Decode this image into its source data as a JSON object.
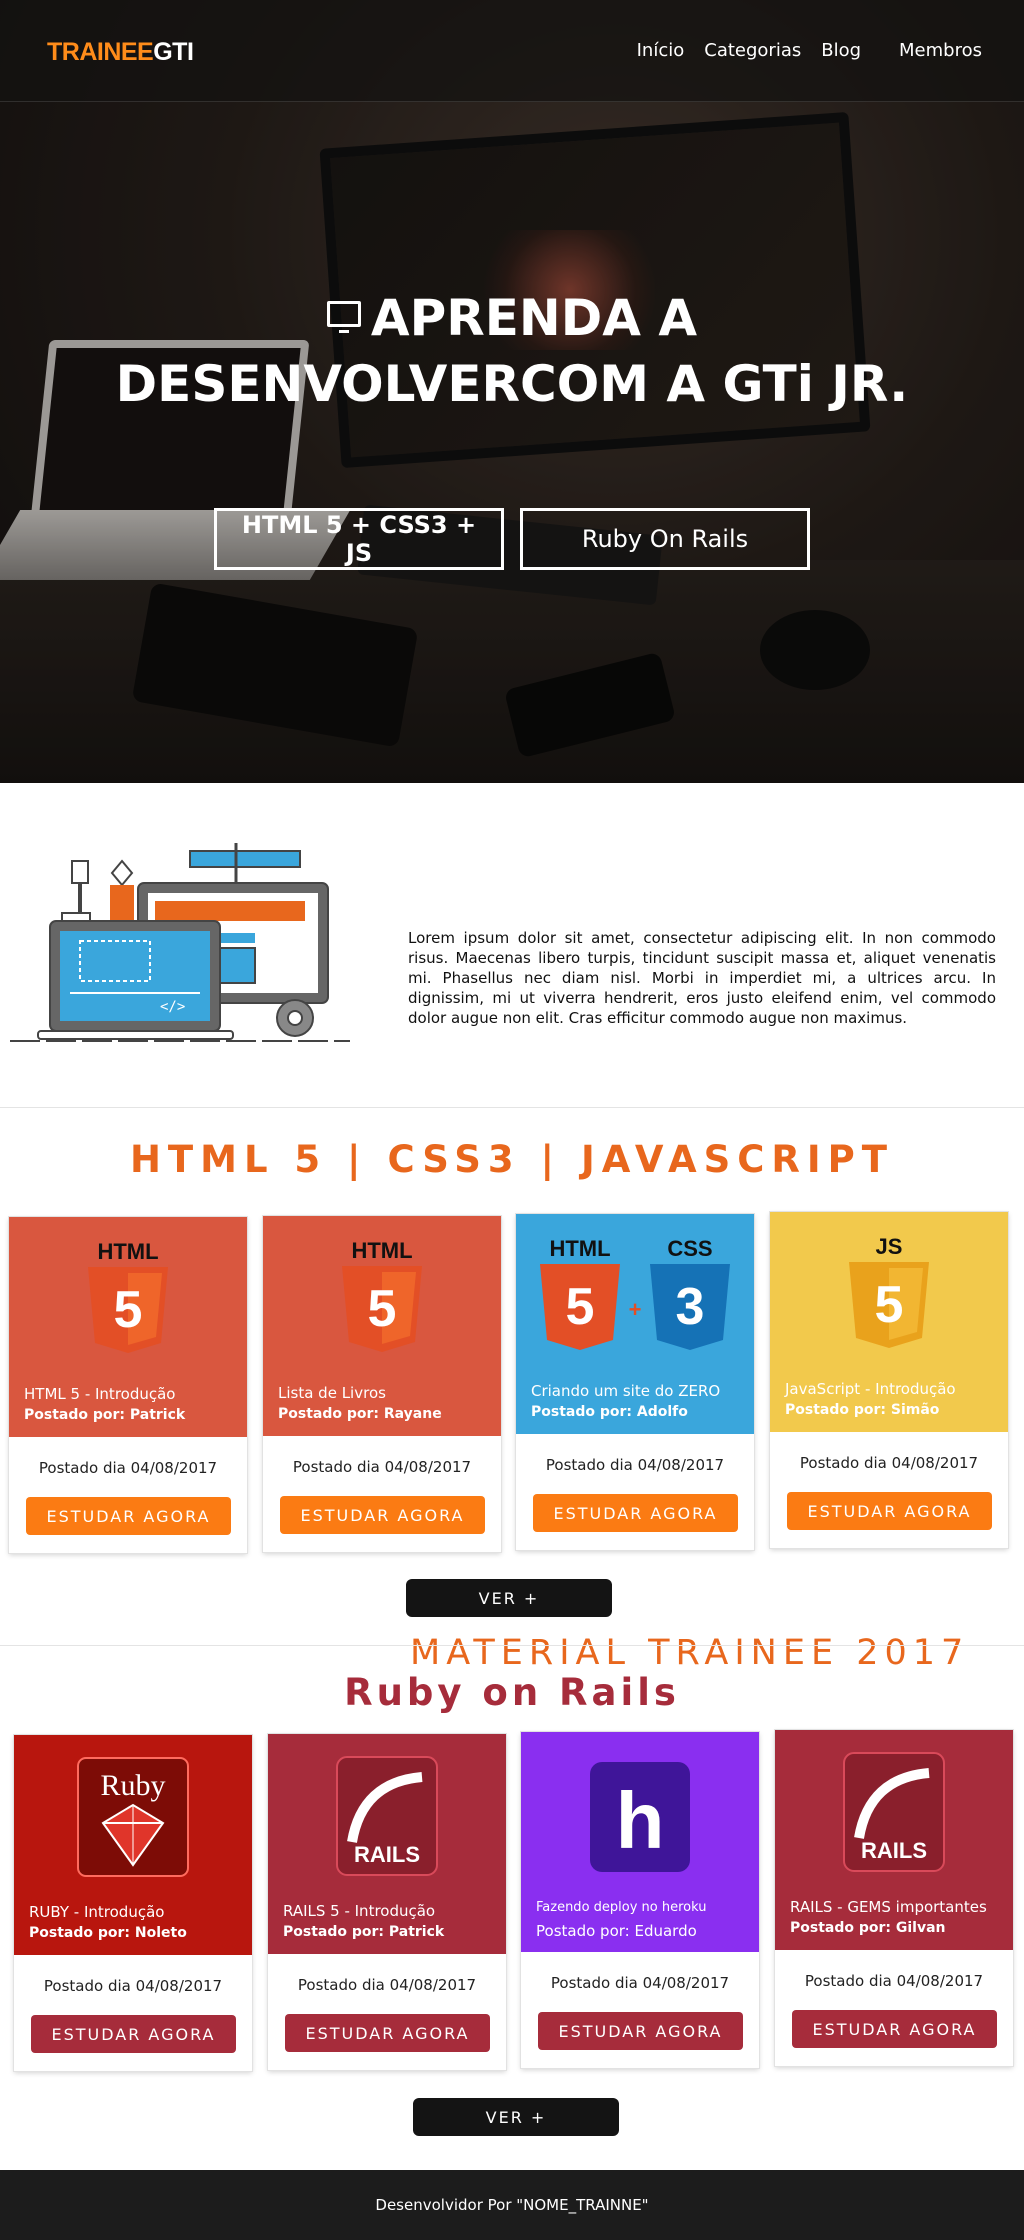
{
  "nav": {
    "logo_part1": "TRAINEE",
    "logo_part2": "GTI",
    "items": [
      {
        "label": "Início"
      },
      {
        "label": "Categorias"
      },
      {
        "label": "Blog"
      },
      {
        "label": "Membros"
      }
    ]
  },
  "hero": {
    "title_line1": "APRENDA A",
    "title_line2": "DESENVOLVERCOM A GTi JR.",
    "buttons": [
      {
        "label": "HTML 5 + CSS3 + JS"
      },
      {
        "label": "Ruby On Rails"
      }
    ]
  },
  "about": {
    "title": "MATERIAL TRAINEE 2017",
    "text": "Lorem ipsum dolor sit amet, consectetur adipiscing elit. In non commodo risus. Maecenas libero turpis, tincidunt suscipit massa et, aliquet venenatis mi. Phasellus nec diam nisl. Morbi in imperdiet mi, a ultrices arcu. In dignissim, mi ut viverra hendrerit, eros justo eleifend enim, vel commodo dolor augue non elit. Cras efficitur commodo augue non maximus."
  },
  "web_section": {
    "title": "HTML 5 | CSS3 | JAVASCRIPT",
    "cards": [
      {
        "title": "HTML 5 - Introdução",
        "author": "Postado por: Patrick",
        "date": "Postado dia 04/08/2017",
        "button": "ESTUDAR AGORA",
        "color": "#d9573f"
      },
      {
        "title": "Lista de Livros",
        "author": "Postado por: Rayane",
        "date": "Postado dia 04/08/2017",
        "button": "ESTUDAR AGORA",
        "color": "#d9573f"
      },
      {
        "title": "Criando um site do ZERO",
        "author": "Postado por: Adolfo",
        "date": "Postado dia 04/08/2017",
        "button": "ESTUDAR AGORA",
        "color": "#3aa6dc"
      },
      {
        "title": "JavaScript - Introdução",
        "author": "Postado por: Simão",
        "date": "Postado dia 04/08/2017",
        "button": "ESTUDAR AGORA",
        "color": "#f2c94c"
      }
    ],
    "more_button": "VER +"
  },
  "rails_section": {
    "title": "Ruby on Rails",
    "cards": [
      {
        "title": "RUBY - Introdução",
        "author": "Postado por: Noleto",
        "date": "Postado dia 04/08/2017",
        "button": "ESTUDAR AGORA",
        "color": "#b8160e"
      },
      {
        "title": "RAILS 5 - Introdução",
        "author": "Postado por: Patrick",
        "date": "Postado dia 04/08/2017",
        "button": "ESTUDAR AGORA",
        "color": "#a62c3b"
      },
      {
        "title": "Fazendo deploy no heroku",
        "author": "Postado por: Eduardo",
        "date": "Postado dia 04/08/2017",
        "button": "ESTUDAR AGORA",
        "color": "#8a2ff0"
      },
      {
        "title": "RAILS - GEMS importantes",
        "author": "Postado por: Gilvan",
        "date": "Postado dia 04/08/2017",
        "button": "ESTUDAR AGORA",
        "color": "#a62c3b"
      }
    ],
    "more_button": "VER +"
  },
  "badges": {
    "html": "HTML",
    "css": "CSS",
    "js": "JS",
    "five": "5",
    "three": "3",
    "plus": "+",
    "ruby": "Ruby",
    "rails": "RAILS",
    "heroku": "h"
  },
  "footer": {
    "text": "Desenvolvidor Por \"NOME_TRAINNE\""
  }
}
